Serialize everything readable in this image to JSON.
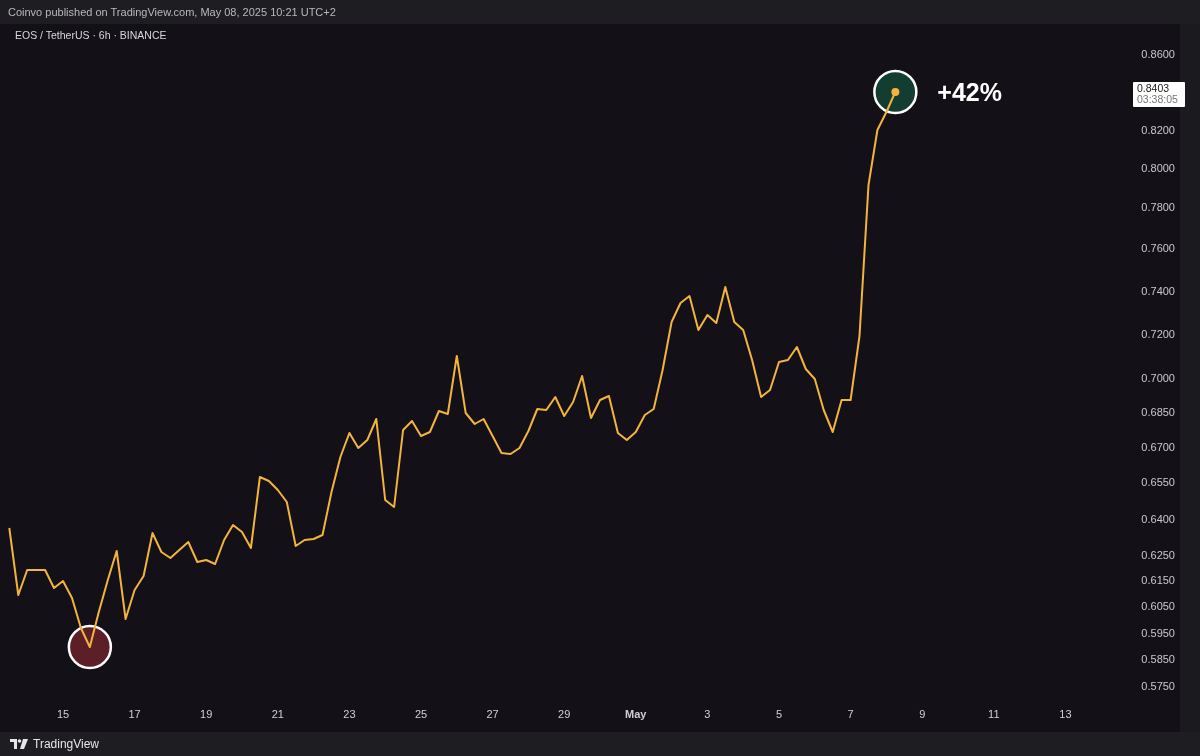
{
  "header": {
    "text": "Coinvo published on TradingView.com, May 08, 2025 10:21 UTC+2"
  },
  "chart": {
    "legend": "EOS / TetherUS · 6h · BINANCE",
    "last_price": {
      "value": "0.8403",
      "countdown": "03:38:05"
    },
    "gain_label": "+42%",
    "highlights": [
      {
        "color": "#5c1f28"
      },
      {
        "color": "#133d31"
      }
    ],
    "price_axis": [
      "0.8600",
      "0.8200",
      "0.8000",
      "0.7800",
      "0.7600",
      "0.7400",
      "0.7200",
      "0.7000",
      "0.6850",
      "0.6700",
      "0.6550",
      "0.6400",
      "0.6250",
      "0.6150",
      "0.6050",
      "0.5950",
      "0.5850",
      "0.5750"
    ],
    "time_axis": [
      {
        "label": "15",
        "kind": "day"
      },
      {
        "label": "17",
        "kind": "day"
      },
      {
        "label": "19",
        "kind": "day"
      },
      {
        "label": "21",
        "kind": "day"
      },
      {
        "label": "23",
        "kind": "day"
      },
      {
        "label": "25",
        "kind": "day"
      },
      {
        "label": "27",
        "kind": "day"
      },
      {
        "label": "29",
        "kind": "day"
      },
      {
        "label": "May",
        "kind": "month"
      },
      {
        "label": "3",
        "kind": "day"
      },
      {
        "label": "5",
        "kind": "day"
      },
      {
        "label": "7",
        "kind": "day"
      },
      {
        "label": "9",
        "kind": "day"
      },
      {
        "label": "11",
        "kind": "day"
      },
      {
        "label": "13",
        "kind": "day"
      }
    ]
  },
  "footer": {
    "brand": "TradingView"
  }
}
